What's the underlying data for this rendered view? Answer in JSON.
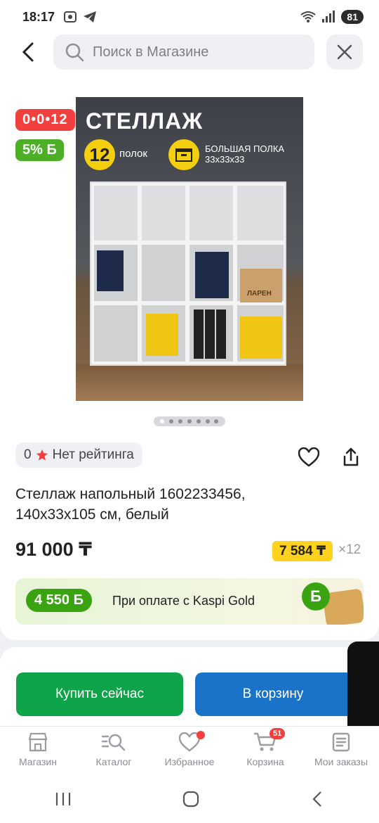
{
  "status_bar": {
    "time": "18:17",
    "battery": "81"
  },
  "search": {
    "placeholder": "Поиск в Магазине"
  },
  "product": {
    "badge_timer": "0•0•12",
    "badge_bonus": "5% Б",
    "image_texts": {
      "title": "СТЕЛЛАЖ",
      "shelves_count": "12",
      "shelves_label": "полок",
      "big_shelf_line1": "БОЛЬШАЯ ПОЛКА",
      "big_shelf_line2": "33x33x33",
      "box_label": "ЛАРЕН"
    },
    "image_slides": 7,
    "rating_value": "0",
    "rating_text": "Нет рейтинга",
    "title_line1": "Стеллаж напольный 1602233456,",
    "title_line2": "140x33x105 см, белый",
    "price": "91 000 ₸",
    "installment_price": "7 584 ₸",
    "installment_months": "×12"
  },
  "kaspi_gold": {
    "bonus": "4 550 Б",
    "text": "При оплате с Kaspi Gold",
    "coin": "Б"
  },
  "actions": {
    "buy_now": "Купить сейчас",
    "add_to_cart": "В корзину"
  },
  "bottom_nav": {
    "items": [
      {
        "label": "Магазин",
        "icon": "store-icon"
      },
      {
        "label": "Каталог",
        "icon": "catalog-search-icon"
      },
      {
        "label": "Избранное",
        "icon": "heart-icon"
      },
      {
        "label": "Корзина",
        "icon": "cart-icon",
        "badge": "51"
      },
      {
        "label": "Мои заказы",
        "icon": "orders-icon"
      }
    ]
  },
  "colors": {
    "accent_green": "#0fa34a",
    "accent_blue": "#1a73c9",
    "red": "#f2403f",
    "yellow": "#ffd21f"
  }
}
